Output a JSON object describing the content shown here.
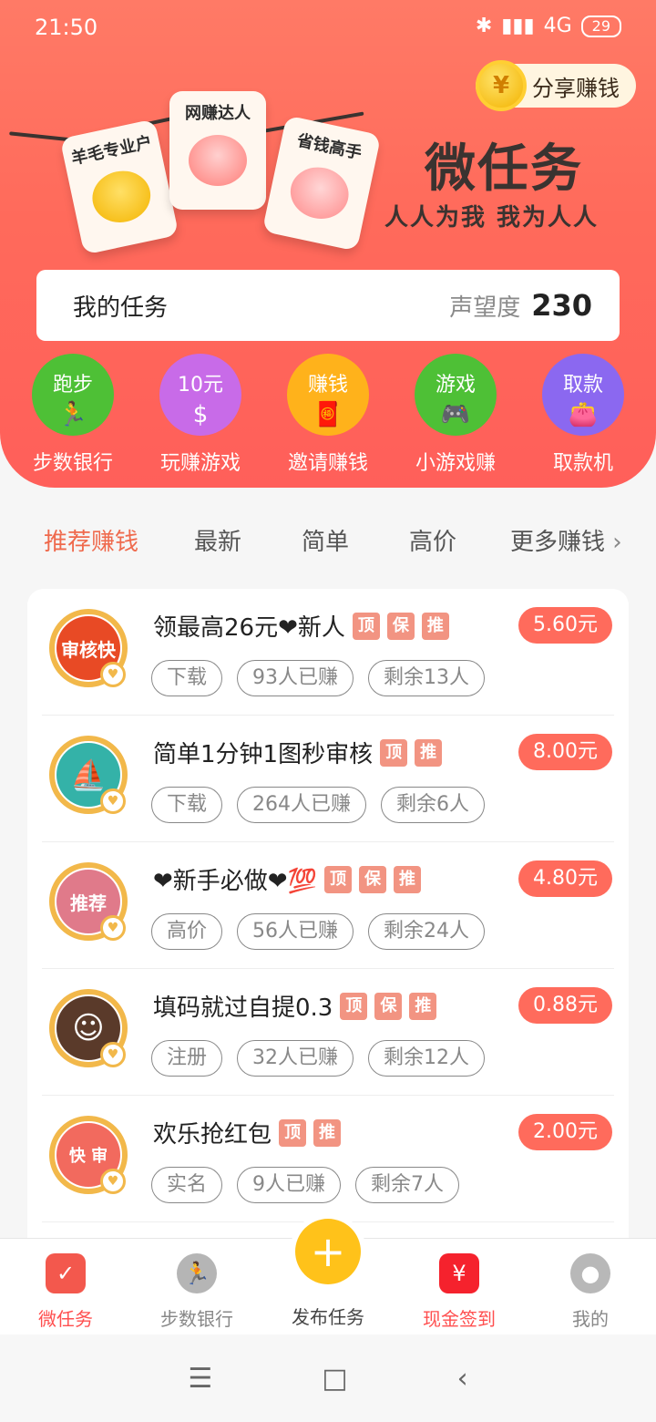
{
  "status": {
    "time": "21:50",
    "network": "4G",
    "battery": "29"
  },
  "header": {
    "share_label": "分享赚钱",
    "coin_symbol": "¥",
    "brand_title": "微任务",
    "brand_sub": "人人为我 我为人人",
    "tags": [
      "羊毛专业户",
      "网赚达人",
      "省钱高手"
    ]
  },
  "my_task": {
    "label": "我的任务",
    "reputation_label": "声望度",
    "reputation_value": "230"
  },
  "quick": [
    {
      "top": "跑步",
      "label": "步数银行",
      "color": "#4ec036"
    },
    {
      "top": "10元",
      "label": "玩赚游戏",
      "color": "#c86be8"
    },
    {
      "top": "赚钱",
      "label": "邀请赚钱",
      "color": "#ffb21b"
    },
    {
      "top": "游戏",
      "label": "小游戏赚",
      "color": "#4ec036"
    },
    {
      "top": "取款",
      "label": "取款机",
      "color": "#8b68f0"
    }
  ],
  "tabs": [
    "推荐赚钱",
    "最新",
    "简单",
    "高价",
    "更多赚钱"
  ],
  "tasks": [
    {
      "title": "领最高26元❤新人",
      "badges": [
        "顶",
        "保",
        "推"
      ],
      "price": "5.60元",
      "chips": [
        "下载",
        "93人已赚",
        "剩余13人"
      ],
      "avatar_text": "审核快",
      "avatar_color": "#e84a25"
    },
    {
      "title": "简单1分钟1图秒审核",
      "badges": [
        "顶",
        "推"
      ],
      "price": "8.00元",
      "chips": [
        "下载",
        "264人已赚",
        "剩余6人"
      ],
      "avatar_text": "⛵",
      "avatar_color": "#34b2a8"
    },
    {
      "title": "❤新手必做❤💯",
      "badges": [
        "顶",
        "保",
        "推"
      ],
      "price": "4.80元",
      "chips": [
        "高价",
        "56人已赚",
        "剩余24人"
      ],
      "avatar_text": "推荐",
      "avatar_color": "#e07a8a"
    },
    {
      "title": "填码就过自提0.3",
      "badges": [
        "顶",
        "保",
        "推"
      ],
      "price": "0.88元",
      "chips": [
        "注册",
        "32人已赚",
        "剩余12人"
      ],
      "avatar_text": "☺",
      "avatar_color": "#5a3a2a"
    },
    {
      "title": "欢乐抢红包",
      "badges": [
        "顶",
        "推"
      ],
      "price": "2.00元",
      "chips": [
        "实名",
        "9人已赚",
        "剩余7人"
      ],
      "avatar_text": "快 审",
      "avatar_color": "#f26a5e"
    }
  ],
  "nav": {
    "items": [
      "微任务",
      "步数银行",
      "发布任务",
      "现金签到",
      "我的"
    ],
    "publish_icon": "+"
  },
  "sys_nav": {
    "menu": "☰",
    "home": "□",
    "back": "‹"
  }
}
